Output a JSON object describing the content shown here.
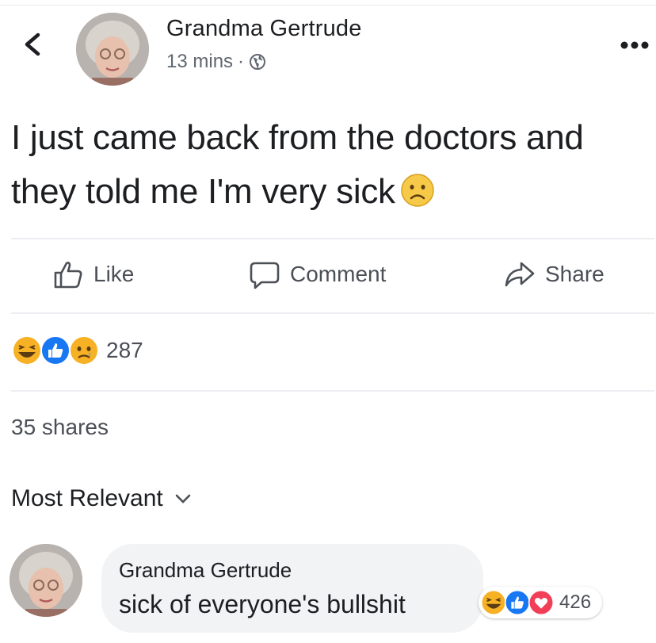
{
  "post": {
    "author": "Grandma Gertrude",
    "time": "13 mins",
    "separator": "·",
    "text": "I just came back from the doctors and they told me I'm very sick"
  },
  "actions": {
    "like": "Like",
    "comment": "Comment",
    "share": "Share"
  },
  "reactions": {
    "icons": [
      "haha-icon",
      "like-icon",
      "sad-icon"
    ],
    "count": "287"
  },
  "shares": "35 shares",
  "comments_filter": "Most Relevant",
  "comment": {
    "author": "Grandma Gertrude",
    "text": "sick of everyone's bullshit",
    "reaction_icons": [
      "haha-icon",
      "like-icon",
      "love-icon"
    ],
    "reaction_count": "426"
  },
  "colors": {
    "like_blue": "#1877f2",
    "love_red": "#f33e58",
    "emoji_yellow": "#f7b125",
    "meta_gray": "#606770"
  }
}
